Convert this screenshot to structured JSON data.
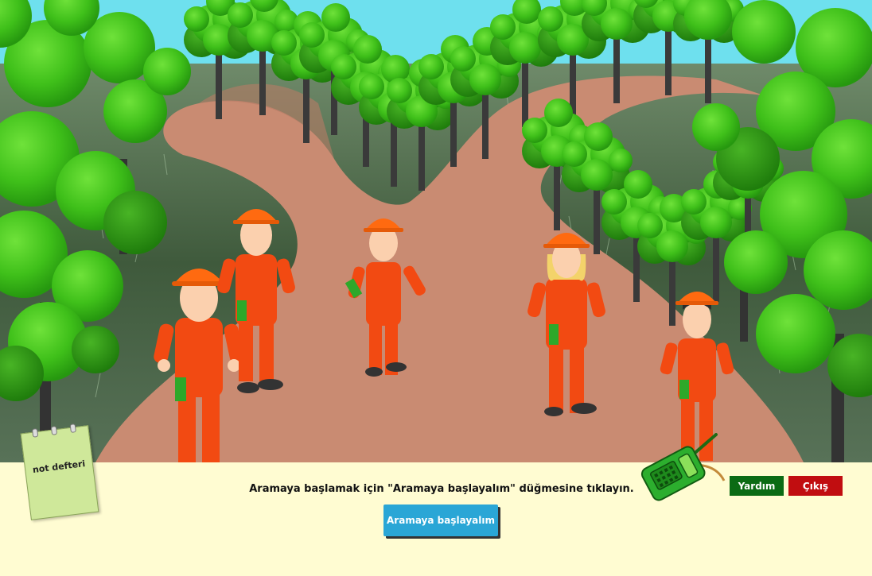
{
  "instruction_text": "Aramaya başlamak için \"Aramaya başlayalım\" düğmesine tıklayın.",
  "start_button_label": "Aramaya başlayalım",
  "help_button_label": "Yardım",
  "exit_button_label": "Çıkış",
  "notebook_label": "not defteri",
  "colors": {
    "panel_background": "#fffcd2",
    "start_button": "#2aa6d6",
    "help_button": "#0b6b14",
    "exit_button": "#c10d10",
    "path": "#c98b72",
    "uniform": "#f24a12",
    "helmet": "#ff6a10",
    "foliage": "#44c21b",
    "sky": "#6ee0ee"
  },
  "icons": [
    "walkie-talkie-icon",
    "notebook-icon"
  ],
  "scene": {
    "characters": [
      "rescuer-1",
      "rescuer-2",
      "rescuer-3",
      "rescuer-4",
      "rescuer-5"
    ]
  }
}
